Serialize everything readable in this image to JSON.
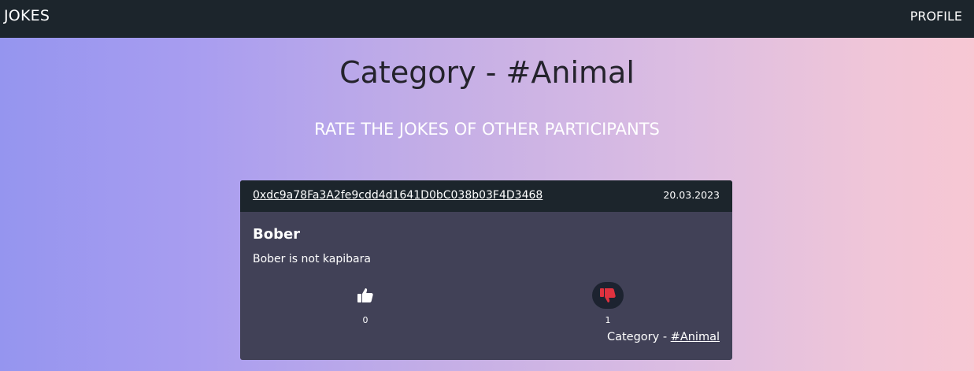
{
  "navbar": {
    "brand": "JOKES",
    "profile_label": "PROFILE"
  },
  "page": {
    "title": "Category - #Animal",
    "subtitle": "RATE THE JOKES OF OTHER PARTICIPANTS"
  },
  "colors": {
    "navbar_bg": "#1c252c",
    "card_bg": "#414157",
    "dislike_active": "#e0323f",
    "gradient_start": "#9595ef",
    "gradient_end": "#f7c7d3"
  },
  "jokes": [
    {
      "author": "0xdc9a78Fa3A2fe9cdd4d1641D0bC038b03F4D3468",
      "date": "20.03.2023",
      "title": "Bober",
      "text": "Bober is not kapibara",
      "likes": "0",
      "dislikes": "1",
      "like_icon": "thumbs-up-icon",
      "dislike_icon": "thumbs-down-icon",
      "category_prefix": "Category - ",
      "category": "#Animal"
    }
  ]
}
